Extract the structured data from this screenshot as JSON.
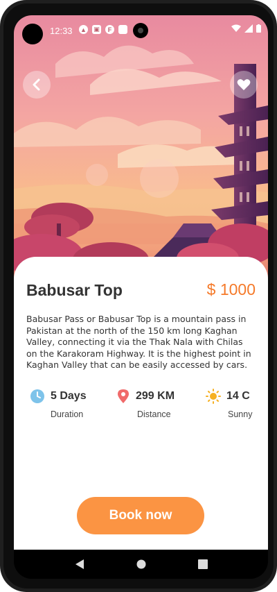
{
  "status_bar": {
    "time": "12:33",
    "icons": [
      "android-icon",
      "image-icon",
      "notification-icon",
      "sd-card-icon"
    ],
    "right_icons": [
      "wifi-icon",
      "signal-icon",
      "battery-icon"
    ]
  },
  "header": {
    "back_icon": "chevron-left-icon",
    "favorite_icon": "heart-icon"
  },
  "destination": {
    "title": "Babusar Top",
    "price": "$ 1000",
    "description": "Babusar Pass or Babusar Top is a mountain pass in Pakistan at the north of the 150 km long Kaghan Valley, connecting it via the Thak Nala with Chilas on the Karakoram Highway. It is the highest point in Kaghan Valley that can be easily accessed by cars."
  },
  "stats": {
    "duration": {
      "value": "5 Days",
      "label": "Duration",
      "icon": "clock-icon"
    },
    "distance": {
      "value": "299 KM",
      "label": "Distance",
      "icon": "location-pin-icon"
    },
    "weather": {
      "value": "14 C",
      "label": "Sunny",
      "icon": "sun-icon"
    }
  },
  "actions": {
    "book_label": "Book now"
  },
  "colors": {
    "accent": "#fb9443",
    "price": "#f57a2a",
    "text": "#333333"
  }
}
